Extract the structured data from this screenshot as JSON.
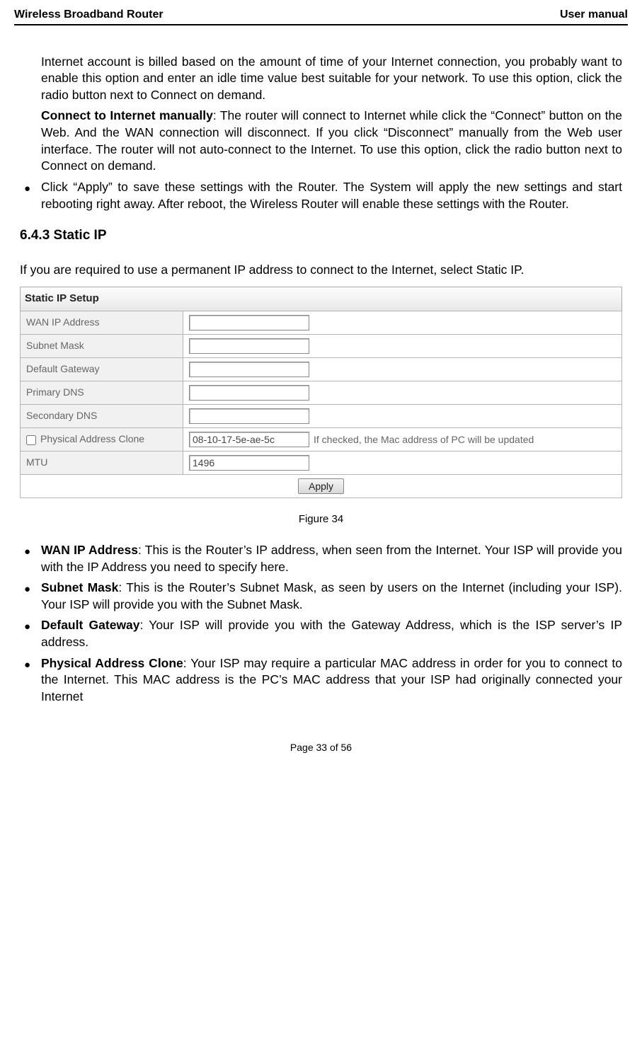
{
  "header": {
    "left": "Wireless Broadband Router",
    "right": "User manual"
  },
  "para_continue": "Internet account is billed based on the amount of time of your Internet connection, you probably want to enable this option and enter an idle time value best suitable for your network. To use this option, click the radio button next to Connect on demand.",
  "para_manual_label": "Connect to Internet manually",
  "para_manual_rest": ": The router will connect to Internet while click the “Connect” button on the Web. And the WAN connection will disconnect. If you click “Disconnect” manually from the Web user interface. The router will not auto-connect to the Internet. To use this option, click the radio button next to Connect on demand.",
  "bullet_apply": "Click “Apply” to save these settings with the Router. The System will apply the new settings and start rebooting right away. After reboot, the Wireless Router will enable these settings with the Router.",
  "section_title": "6.4.3 Static IP",
  "lead": "If you are required to use a permanent IP address to connect to the Internet, select Static IP.",
  "panel_title": "Static IP Setup",
  "fields": {
    "wan_ip": "WAN IP Address",
    "subnet": "Subnet Mask",
    "gateway": "Default Gateway",
    "pdns": "Primary DNS",
    "sdns": "Secondary DNS",
    "clone_label": "Physical Address Clone",
    "clone_value": "08-10-17-5e-ae-5c",
    "clone_note": "If checked, the Mac address of PC will be updated",
    "mtu_label": "MTU",
    "mtu_value": "1496"
  },
  "apply_label": "Apply",
  "figure_caption": "Figure 34",
  "bullets2": {
    "wan_label": "WAN IP Address",
    "wan_text": ": This is the Router’s IP address, when seen from the Internet. Your ISP will provide you with the IP Address you need to specify here.",
    "subnet_label": "Subnet Mask",
    "subnet_text": ": This is the Router’s Subnet Mask, as seen by users on the Internet (including your ISP). Your ISP will provide you with the Subnet Mask.",
    "gateway_label": "Default Gateway",
    "gateway_text": ": Your ISP will provide you with the Gateway Address, which is the ISP server’s IP address.",
    "clone_label": "Physical Address Clone",
    "clone_text": ": Your ISP may require a particular MAC address in order for you to connect to the Internet. This MAC address is the PC’s MAC address that your ISP had originally connected your Internet"
  },
  "footer": "Page 33 of 56"
}
